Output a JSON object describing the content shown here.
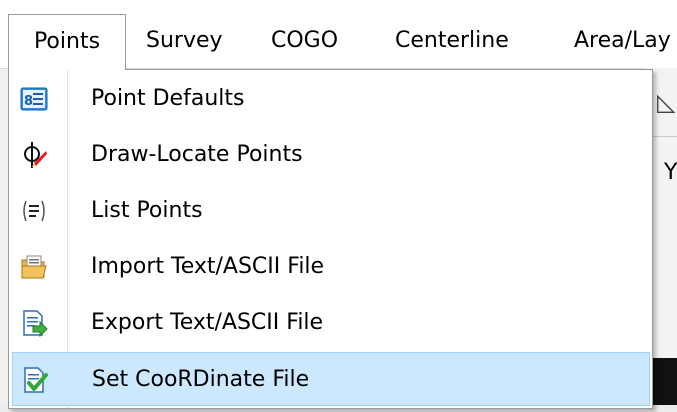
{
  "menubar": {
    "items": [
      {
        "label": "Points"
      },
      {
        "label": "Survey"
      },
      {
        "label": "COGO"
      },
      {
        "label": "Centerline"
      },
      {
        "label": "Area/Lay"
      }
    ]
  },
  "background": {
    "partial_text": "YI"
  },
  "dropdown": {
    "items": [
      {
        "label": "Point Defaults",
        "icon": "point-defaults-icon"
      },
      {
        "label": "Draw-Locate Points",
        "icon": "draw-locate-icon"
      },
      {
        "label": "List Points",
        "icon": "list-points-icon"
      },
      {
        "label": "Import Text/ASCII File",
        "icon": "import-folder-icon"
      },
      {
        "label": "Export Text/ASCII File",
        "icon": "export-file-icon"
      },
      {
        "label": "Set CooRDinate File",
        "icon": "set-coordinate-file-icon",
        "selected": true
      }
    ]
  },
  "colors": {
    "highlight": "#cce8ff",
    "highlight_border": "#99d1ff",
    "menu_border": "#9a9a9a"
  }
}
